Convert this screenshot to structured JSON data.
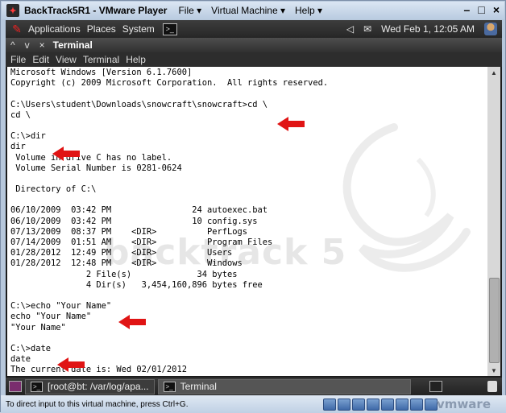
{
  "vmware": {
    "title": "BackTrack5R1 - VMware Player",
    "menus": [
      "File ▾",
      "Virtual Machine ▾",
      "Help ▾"
    ],
    "window_controls": [
      "–",
      "□",
      "×"
    ],
    "status_hint": "To direct input to this virtual machine, press Ctrl+G.",
    "brand": "vmware"
  },
  "gnome_top": {
    "menus": [
      "Applications",
      "Places",
      "System"
    ],
    "clock": "Wed Feb  1, 12:05 AM"
  },
  "terminal": {
    "title": "Terminal",
    "title_buttons": [
      "^",
      "v",
      "×"
    ],
    "menu": [
      "File",
      "Edit",
      "View",
      "Terminal",
      "Help"
    ],
    "lines": [
      "Microsoft Windows [Version 6.1.7600]",
      "Copyright (c) 2009 Microsoft Corporation.  All rights reserved.",
      "",
      "C:\\Users\\student\\Downloads\\snowcraft\\snowcraft>cd \\",
      "cd \\",
      "",
      "C:\\>dir",
      "dir",
      " Volume in drive C has no label.",
      " Volume Serial Number is 0281-0624",
      "",
      " Directory of C:\\",
      "",
      "06/10/2009  03:42 PM                24 autoexec.bat",
      "06/10/2009  03:42 PM                10 config.sys",
      "07/13/2009  08:37 PM    <DIR>          PerfLogs",
      "07/14/2009  01:51 AM    <DIR>          Program Files",
      "01/28/2012  12:49 PM    <DIR>          Users",
      "01/28/2012  12:48 PM    <DIR>          Windows",
      "               2 File(s)             34 bytes",
      "               4 Dir(s)   3,454,160,896 bytes free",
      "",
      "C:\\>echo \"Your Name\"",
      "echo \"Your Name\"",
      "\"Your Name\"",
      "",
      "C:\\>date",
      "date",
      "The current date is: Wed 02/01/2012"
    ]
  },
  "watermark": {
    "text": "backtrack 5"
  },
  "taskbar": {
    "items": [
      "[root@bt: /var/log/apa...",
      "Terminal"
    ]
  },
  "colors": {
    "arrow": "#e01414",
    "terminal_bg": "#ffffff"
  }
}
